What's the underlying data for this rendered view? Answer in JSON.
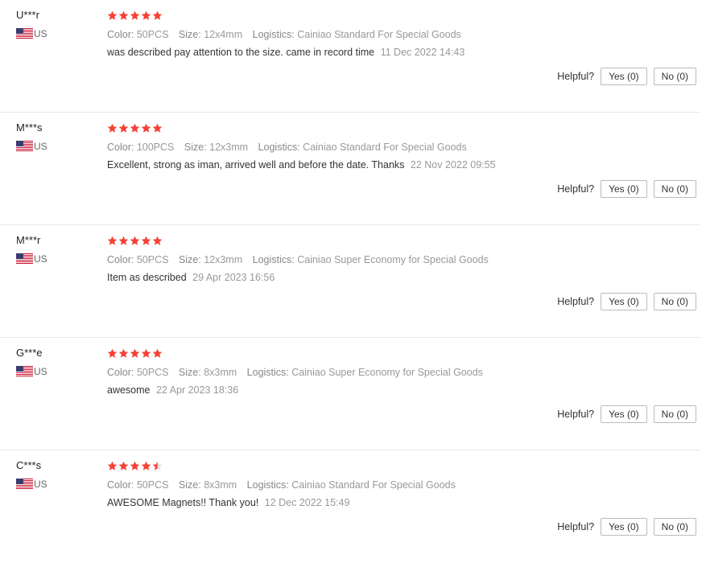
{
  "helpful_label": "Helpful?",
  "reviews": [
    {
      "user": "U***r",
      "country": "US",
      "rating": 5,
      "meta": {
        "color_label": "Color:",
        "color": "50PCS",
        "size_label": "Size:",
        "size": "12x4mm",
        "logistics_label": "Logistics:",
        "logistics": "Cainiao Standard For Special Goods"
      },
      "text": "was described pay attention to the size. came in record time",
      "date": "11 Dec 2022 14:43",
      "yes": "Yes (0)",
      "no": "No (0)"
    },
    {
      "user": "M***s",
      "country": "US",
      "rating": 5,
      "meta": {
        "color_label": "Color:",
        "color": "100PCS",
        "size_label": "Size:",
        "size": "12x3mm",
        "logistics_label": "Logistics:",
        "logistics": "Cainiao Standard For Special Goods"
      },
      "text": "Excellent, strong as iman, arrived well and before the date. Thanks",
      "date": "22 Nov 2022 09:55",
      "yes": "Yes (0)",
      "no": "No (0)"
    },
    {
      "user": "M***r",
      "country": "US",
      "rating": 5,
      "meta": {
        "color_label": "Color:",
        "color": "50PCS",
        "size_label": "Size:",
        "size": "12x3mm",
        "logistics_label": "Logistics:",
        "logistics": "Cainiao Super Economy for Special Goods"
      },
      "text": "Item as described",
      "date": "29 Apr 2023 16:56",
      "yes": "Yes (0)",
      "no": "No (0)"
    },
    {
      "user": "G***e",
      "country": "US",
      "rating": 5,
      "meta": {
        "color_label": "Color:",
        "color": "50PCS",
        "size_label": "Size:",
        "size": "8x3mm",
        "logistics_label": "Logistics:",
        "logistics": "Cainiao Super Economy for Special Goods"
      },
      "text": "awesome",
      "date": "22 Apr 2023 18:36",
      "yes": "Yes (0)",
      "no": "No (0)"
    },
    {
      "user": "C***s",
      "country": "US",
      "rating": 4.5,
      "meta": {
        "color_label": "Color:",
        "color": "50PCS",
        "size_label": "Size:",
        "size": "8x3mm",
        "logistics_label": "Logistics:",
        "logistics": "Cainiao Standard For Special Goods"
      },
      "text": "AWESOME Magnets!! Thank you!",
      "date": "12 Dec 2022 15:49",
      "yes": "Yes (0)",
      "no": "No (0)"
    }
  ],
  "colors": {
    "star": "#f44336",
    "star_empty": "#dddddd",
    "text": "#333333",
    "muted": "#999999"
  },
  "icons": {
    "star": "star-icon",
    "flag": "us-flag-icon"
  }
}
